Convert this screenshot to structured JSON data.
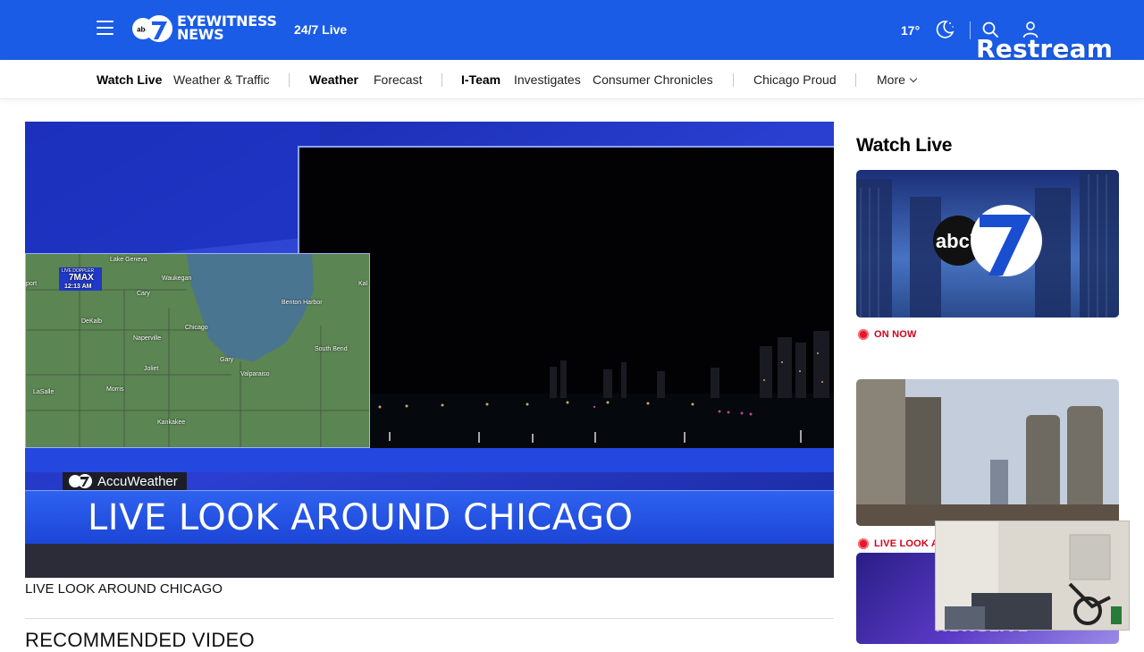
{
  "header": {
    "logo_text_line1": "EYEWITNESS",
    "logo_text_line2": "NEWS",
    "logo_badge": "abc",
    "live_link": "24/7 Live",
    "temperature": "17°",
    "weather_icon": "moon-cloud-icon",
    "overlay_brand": "Restream"
  },
  "nav": {
    "items": [
      {
        "label": "Watch Live",
        "bold": true
      },
      {
        "label": "Weather & Traffic",
        "bold": false
      },
      {
        "label": "Weather",
        "bold": true
      },
      {
        "label": "Forecast",
        "bold": false
      },
      {
        "label": "I-Team",
        "bold": true
      },
      {
        "label": "Investigates",
        "bold": false
      },
      {
        "label": "Consumer Chronicles",
        "bold": false
      },
      {
        "label": "Chicago Proud",
        "bold": false
      },
      {
        "label": "More",
        "bold": false
      }
    ]
  },
  "player": {
    "map": {
      "brand_line1": "LIVE DOPPLER",
      "brand_line2": "7MAX",
      "time": "12:13 AM",
      "places": [
        "Lake Geneva",
        "Waukegan",
        "Cary",
        "DeKalb",
        "Naperville",
        "Chicago",
        "Benton Harbor",
        "South Bend",
        "Joliet",
        "Gary",
        "Valparaiso",
        "Morris",
        "LaSalle",
        "Kankakee",
        "Kal",
        "port"
      ]
    },
    "accuweather_tag": "AccuWeather",
    "headline": "LIVE LOOK AROUND CHICAGO",
    "caption": "LIVE LOOK AROUND CHICAGO"
  },
  "recommended": {
    "heading": "RECOMMENDED VIDEO"
  },
  "sidebar": {
    "title": "Watch Live",
    "cards": [
      {
        "badge": "ON NOW",
        "logo": "abc7"
      },
      {
        "badge": "LIVE LOOK A"
      },
      {
        "watermark": "NEWSLIVE"
      }
    ]
  },
  "colors": {
    "brand_blue": "#1a5ce6",
    "live_red": "#d0021b",
    "headline_bar": "#1c45d6"
  }
}
